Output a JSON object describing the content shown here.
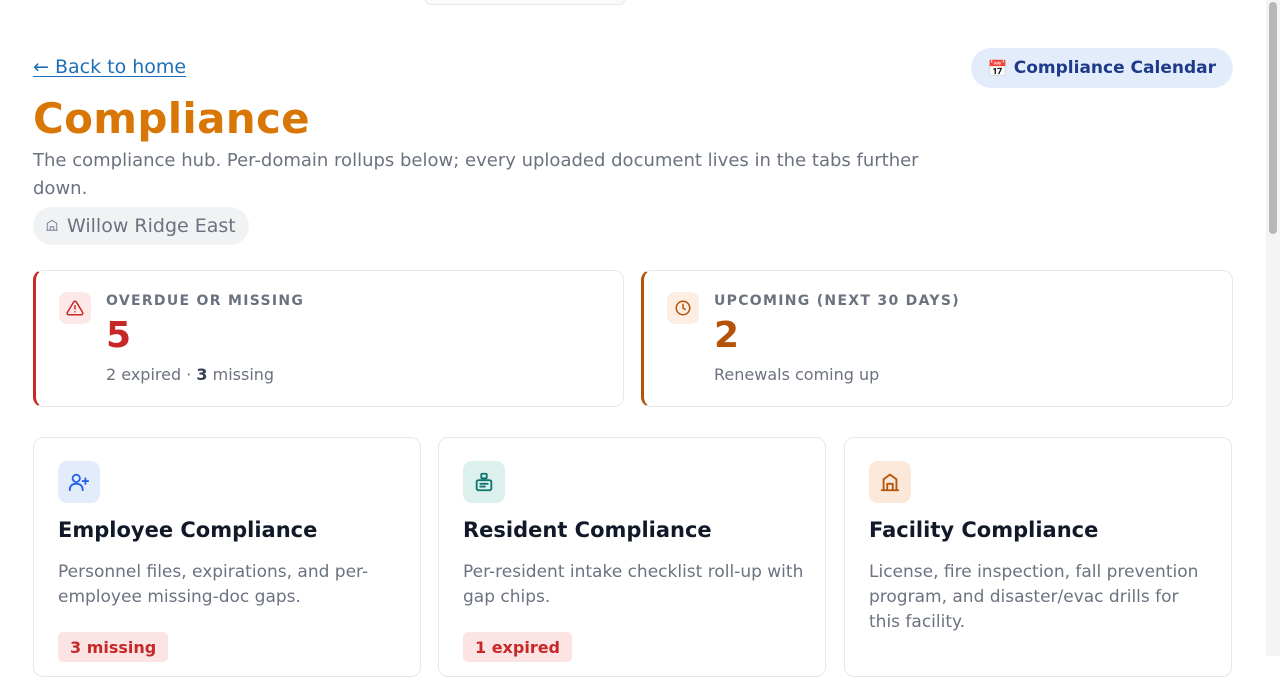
{
  "nav": {
    "back_label": "← Back to home",
    "calendar_button": {
      "icon": "calendar-icon",
      "glyph": "📅",
      "label": "Compliance Calendar"
    }
  },
  "header": {
    "title": "Compliance",
    "subtitle": "The compliance hub. Per-domain rollups below; every uploaded document lives in the tabs further down.",
    "facility": {
      "icon": "building-icon",
      "name": "Willow Ridge East"
    }
  },
  "stats": [
    {
      "icon": "alert-triangle-icon",
      "label": "OVERDUE OR MISSING",
      "value": "5",
      "detail_prefix": "2 expired · ",
      "detail_count": "3",
      "detail_suffix": " missing",
      "accent": "#c62828"
    },
    {
      "icon": "clock-icon",
      "label": "UPCOMING (NEXT 30 DAYS)",
      "value": "2",
      "detail": "Renewals coming up",
      "accent": "#b45309"
    }
  ],
  "domains": [
    {
      "icon": "user-plus-icon",
      "title": "Employee Compliance",
      "description": "Personnel files, expirations, and per-employee missing-doc gaps.",
      "badge": "3 missing"
    },
    {
      "icon": "clipboard-icon",
      "title": "Resident Compliance",
      "description": "Per-resident intake checklist roll-up with gap chips.",
      "badge": "1 expired"
    },
    {
      "icon": "building-icon",
      "title": "Facility Compliance",
      "description": "License, fire inspection, fall prevention program, and disaster/evac drills for this facility."
    }
  ],
  "colors": {
    "title": "#d97706",
    "link": "#1e6fb8",
    "calendar_bg": "#e3ecfb",
    "danger": "#c62828",
    "warning": "#b45309"
  }
}
